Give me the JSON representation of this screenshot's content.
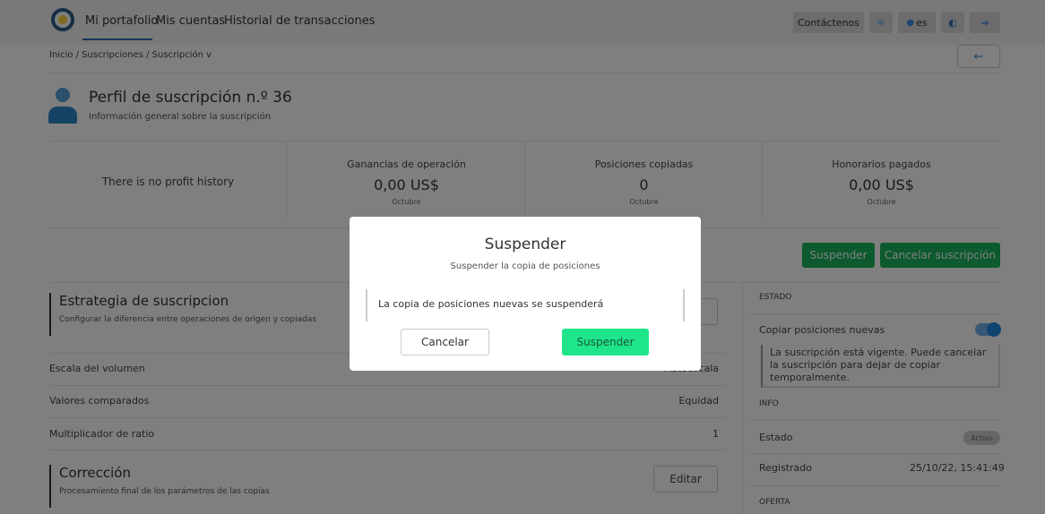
{
  "nav": {
    "items": [
      "Mi portafolio",
      "Mis cuentas",
      "Historial de transacciones"
    ],
    "contact": "Contáctenos",
    "language": "es",
    "icons": [
      "settings-icon",
      "globe-icon",
      "theme-icon",
      "logout-icon"
    ]
  },
  "breadcrumb": "Inicio / Suscripciones / Suscripción v",
  "header": {
    "title": "Perfil de suscripción n.º 36",
    "subtitle": "Información general sobre la suscripción"
  },
  "stats": {
    "no_profit": "There is no profit history",
    "items": [
      {
        "label": "Ganancias de operación",
        "value": "0,00 US$",
        "period": "Octubre"
      },
      {
        "label": "Posiciones copiadas",
        "value": "0",
        "period": "Octubre"
      },
      {
        "label": "Honorarios pagados",
        "value": "0,00 US$",
        "period": "Octubre"
      }
    ]
  },
  "actions": {
    "suspend": "Suspender",
    "cancel_subscription": "Cancelar suscripción"
  },
  "strategy": {
    "title": "Estrategia de suscripcion",
    "subtitle": "Configurar la diferencia entre operaciones de origen y copiadas",
    "rows": [
      {
        "label": "Escala del volumen",
        "value": "Autoescala"
      },
      {
        "label": "Valores comparados",
        "value": "Equidad"
      },
      {
        "label": "Multiplicador de ratio",
        "value": "1"
      }
    ]
  },
  "correction": {
    "title": "Corrección",
    "subtitle": "Procesamiento final de los parámetros de las copias",
    "edit": "Editar"
  },
  "sidebar": {
    "estado_head": "ESTADO",
    "copy_label": "Copiar posiciones nuevas",
    "copy_enabled": true,
    "note": "La suscripción está vigente. Puede cancelar la suscripción para dejar de copiar temporalmente.",
    "info_head": "INFO",
    "state_label": "Estado",
    "state_value": "Activo",
    "registered_label": "Registrado",
    "registered_value": "25/10/22, 15:41:49",
    "offer_head": "OFERTA"
  },
  "modal": {
    "title": "Suspender",
    "subtitle": "Suspender la copia de posiciones",
    "message": "La copia de posiciones nuevas se suspenderá",
    "cancel": "Cancelar",
    "confirm": "Suspender"
  }
}
